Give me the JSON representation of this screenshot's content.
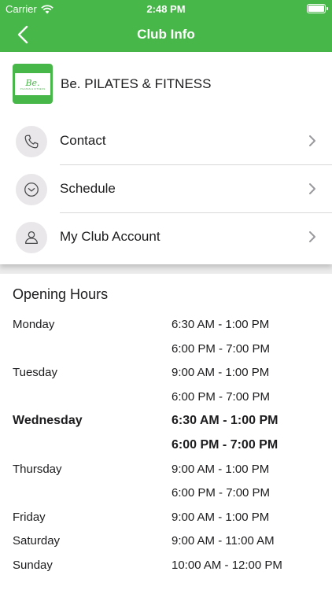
{
  "status_bar": {
    "carrier": "Carrier",
    "time": "2:48 PM"
  },
  "nav": {
    "title": "Club Info"
  },
  "club": {
    "name": "Be. PILATES & FITNESS",
    "logo_text": "Be.",
    "logo_subtext": "PILATES & FITNESS"
  },
  "menu": {
    "contact": "Contact",
    "schedule": "Schedule",
    "account": "My Club Account"
  },
  "hours": {
    "title": "Opening Hours",
    "days": [
      {
        "name": "Monday",
        "times": [
          "6:30 AM - 1:00 PM",
          "6:00 PM - 7:00 PM"
        ],
        "today": false
      },
      {
        "name": "Tuesday",
        "times": [
          "9:00 AM - 1:00 PM",
          "6:00 PM - 7:00 PM"
        ],
        "today": false
      },
      {
        "name": "Wednesday",
        "times": [
          "6:30 AM - 1:00 PM",
          "6:00 PM - 7:00 PM"
        ],
        "today": true
      },
      {
        "name": "Thursday",
        "times": [
          "9:00 AM - 1:00 PM",
          "6:00 PM - 7:00 PM"
        ],
        "today": false
      },
      {
        "name": "Friday",
        "times": [
          "9:00 AM - 1:00 PM"
        ],
        "today": false
      },
      {
        "name": "Saturday",
        "times": [
          "9:00 AM - 11:00 AM"
        ],
        "today": false
      },
      {
        "name": "Sunday",
        "times": [
          "10:00 AM - 12:00 PM"
        ],
        "today": false
      }
    ]
  },
  "colors": {
    "brand_green": "#48b749",
    "icon_bg": "#e9e7e9",
    "band_gray": "#ebebeb"
  }
}
